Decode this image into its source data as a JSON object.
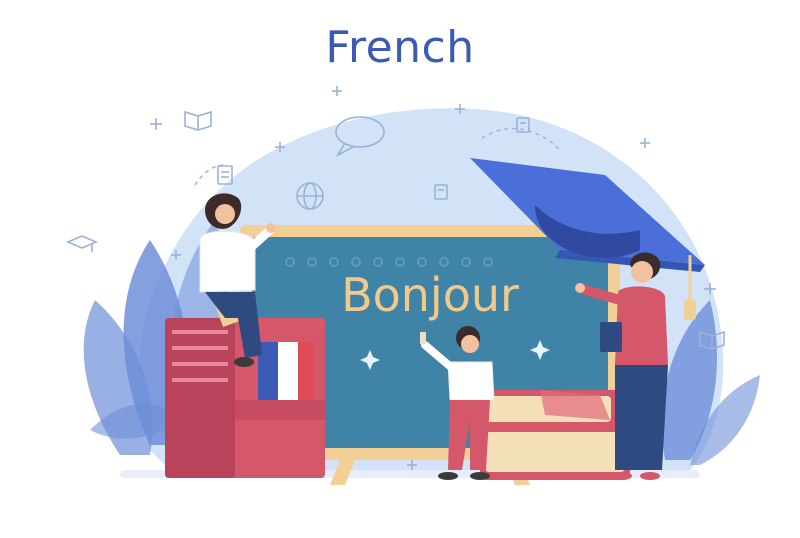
{
  "title": "French",
  "board_word": "Bonjour",
  "colors": {
    "title": "#3b5ab5",
    "blob": "#d3e3f7",
    "leaf": "#6e8fd8",
    "board_frame": "#f2cf95",
    "board_face": "#3f84a6",
    "cap": "#4a6fd8",
    "book_red": "#d4576a",
    "book_cream": "#f4e0b8",
    "flag_blue": "#3b5ab5",
    "flag_red": "#e04c56"
  },
  "icons": [
    "book-icon",
    "speech-bubble-icon",
    "globe-icon",
    "document-icon",
    "graduation-cap-icon",
    "sparkle-icon"
  ]
}
